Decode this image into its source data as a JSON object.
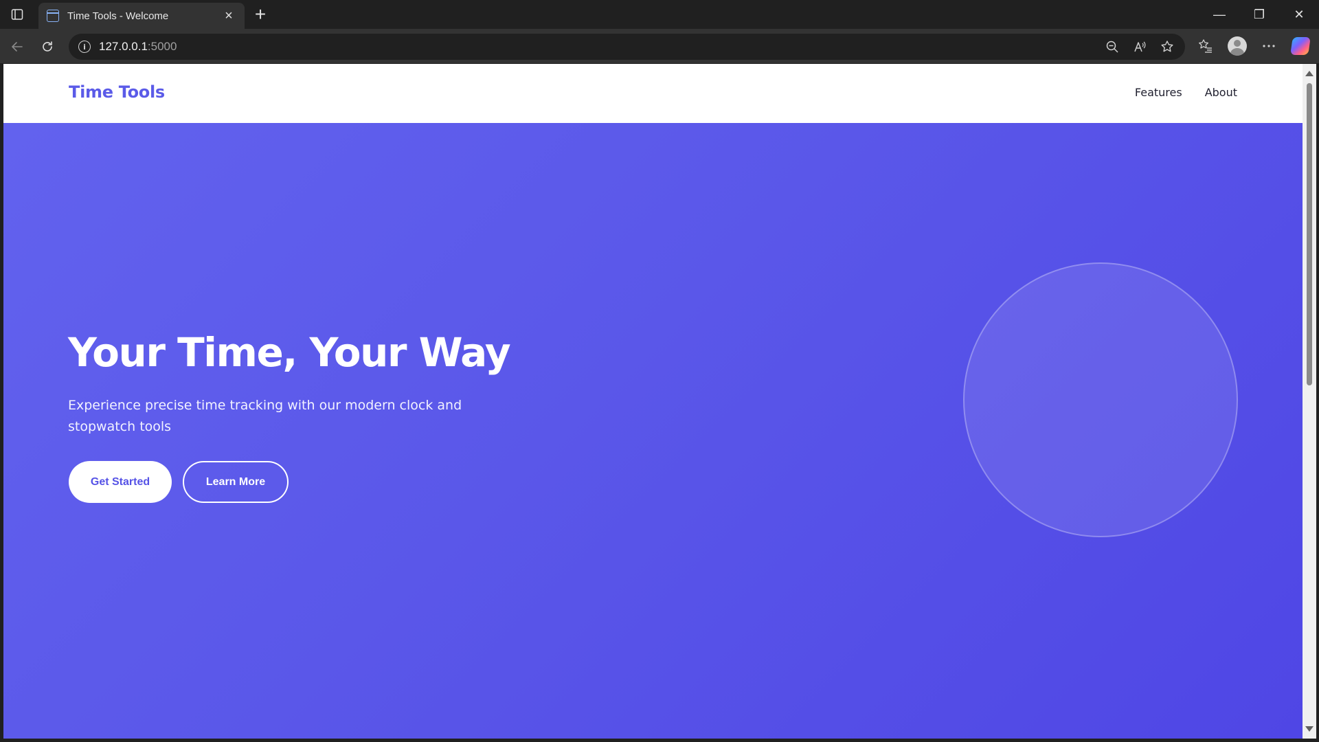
{
  "browser": {
    "tab": {
      "title": "Time Tools - Welcome",
      "close_glyph": "×"
    },
    "new_tab_glyph": "+",
    "window_controls": {
      "minimize": "—",
      "restore": "❐",
      "close": "✕"
    },
    "address": {
      "host": "127.0.0.1",
      "port": ":5000"
    },
    "icons": [
      "tab-actions-icon",
      "back-icon",
      "refresh-icon",
      "site-info-icon",
      "zoom-out-icon",
      "read-aloud-icon",
      "favorite-star-icon",
      "favorites-list-icon",
      "profile-avatar",
      "more-icon",
      "copilot-icon"
    ]
  },
  "site": {
    "logo": "Time Tools",
    "nav": [
      {
        "label": "Features"
      },
      {
        "label": "About"
      }
    ],
    "hero": {
      "title": "Your Time, Your Way",
      "subtitle": "Experience precise time tracking with our modern clock and stopwatch tools",
      "primary_button": "Get Started",
      "secondary_button": "Learn More"
    }
  },
  "colors": {
    "brand": "#5b5be8",
    "hero_gradient_start": "#6262ee",
    "hero_gradient_end": "#4f46e5"
  }
}
